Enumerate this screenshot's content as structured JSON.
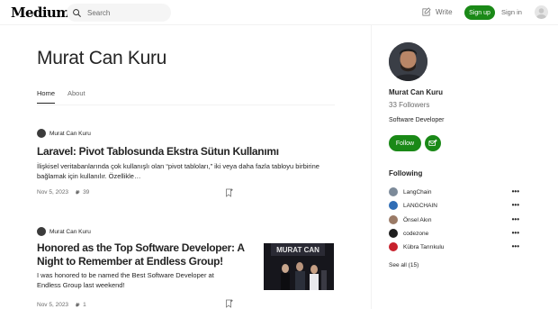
{
  "header": {
    "logo": "Medium",
    "search_placeholder": "Search",
    "write_label": "Write",
    "signup_label": "Sign up",
    "signin_label": "Sign in"
  },
  "author": {
    "name": "Murat Can Kuru"
  },
  "tabs": [
    {
      "label": "Home",
      "active": true
    },
    {
      "label": "About",
      "active": false
    }
  ],
  "posts": [
    {
      "author": "Murat Can Kuru",
      "title": "Laravel: Pivot Tablosunda Ekstra Sütun Kullanımı",
      "excerpt": "İlişkisel veritabanlarında çok kullanışlı olan “pivot tabloları,” iki veya daha fazla tabloyu birbirine bağlamak için kullanılır. Özellikle…",
      "date": "Nov 5, 2023",
      "claps": "39"
    },
    {
      "author": "Murat Can Kuru",
      "title": "Honored as the Top Software Developer: A Night to Remember at Endless Group!",
      "excerpt": "I was honored to be named the Best Software Developer at Endless Group last weekend!",
      "date": "Nov 5, 2023",
      "claps": "1",
      "thumb_text": "MURAT CAN"
    }
  ],
  "sidebar": {
    "name": "Murat Can Kuru",
    "followers": "33 Followers",
    "bio": "Software Developer",
    "follow_label": "Follow",
    "following_title": "Following",
    "following": [
      {
        "name": "LangChain",
        "color": "#7c8a99"
      },
      {
        "name": "LANGCHAIN",
        "color": "#2f6db5"
      },
      {
        "name": "Önsel Akın",
        "color": "#9a7a66"
      },
      {
        "name": "codezone",
        "color": "#1e1e1e"
      },
      {
        "name": "Kübra Tanrıkulu",
        "color": "#c7202c"
      }
    ],
    "see_all": "See all (15)"
  },
  "colors": {
    "brand_green": "#1a8917",
    "text": "#242424",
    "muted": "#6b6b6b"
  }
}
